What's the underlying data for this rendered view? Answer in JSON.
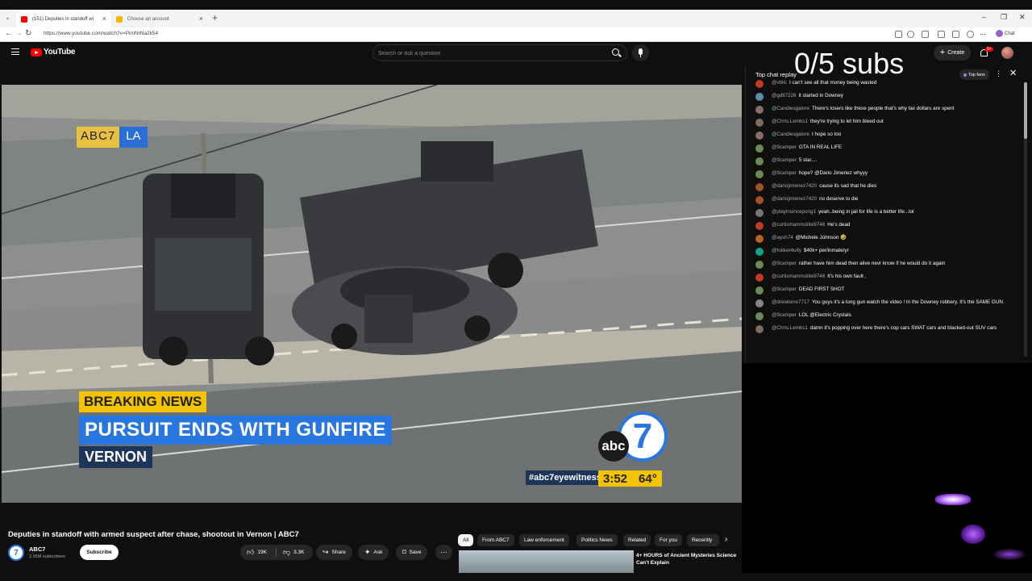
{
  "browser": {
    "tabs": [
      {
        "label": "(151) Deputies in standoff wi"
      },
      {
        "label": "Choose an account"
      }
    ],
    "url": "https://www.youtube.com/watch?v=PimNrNa2k54",
    "chat_label": "Chat"
  },
  "header": {
    "logo_text": "YouTube",
    "search_placeholder": "Search or ask a question",
    "create_label": "Create",
    "notification_count": "9+"
  },
  "video": {
    "bug_left": "ABC7",
    "bug_right": "LA",
    "breaking": "BREAKING NEWS",
    "headline": "PURSUIT ENDS WITH GUNFIRE",
    "location": "VERNON",
    "network_abc": "abc",
    "network_7": "7",
    "hashtag": "#abc7eyewitness",
    "clock": "3:52",
    "temperature": "64°"
  },
  "meta": {
    "title": "Deputies in standoff with armed suspect after chase, shootout in Vernon | ABC7",
    "channel": "ABC7",
    "subscribers": "2.95M subscribers",
    "subscribe_label": "Subscribe",
    "likes": "19K",
    "dislikes": "3.3K",
    "share_label": "Share",
    "ask_label": "Ask",
    "save_label": "Save"
  },
  "chips": [
    "All",
    "From ABC7",
    "Law enforcement",
    "Politics News",
    "Related",
    "For you",
    "Recently"
  ],
  "related": {
    "title": "4+ HOURS of Ancient Mysteries Science Can't Explain"
  },
  "chat": {
    "header": "Top chat replay",
    "top_fans_label": "Top fans",
    "messages": [
      {
        "author": "@vblic",
        "text": "I can't see all that money being wasted",
        "color": "#c0392b"
      },
      {
        "author": "@gdlt7226",
        "text": "it started in Downey",
        "color": "#5b8fa8"
      },
      {
        "author": "@Candlesgalore",
        "text": "There's losers like these people that's why tax dollars are spent",
        "color": "#8e6b6b"
      },
      {
        "author": "@Chris.Lemks1",
        "text": "they're trying to let him bleed out",
        "color": "#7f6a5a"
      },
      {
        "author": "@Candlesgalore",
        "text": "I hope so too",
        "color": "#8e6b6b"
      },
      {
        "author": "@9camper",
        "text": "GTA IN REAL LIFE",
        "color": "#6a8a5a"
      },
      {
        "author": "@9camper",
        "text": "5 star....",
        "color": "#6a8a5a"
      },
      {
        "author": "@9camper",
        "text": "hope? @Dario Jimenez whyyy",
        "color": "#6a8a5a"
      },
      {
        "author": "@dariojimenez7420",
        "text": "cause its sad that he dies",
        "color": "#a0522d"
      },
      {
        "author": "@dariojimenez7420",
        "text": "no deserve to die",
        "color": "#a0522d"
      },
      {
        "author": "@playinsincepong1",
        "text": "yeah..being in jail for life is a better life...lol",
        "color": "#777777"
      },
      {
        "author": "@curtismammolite9746",
        "text": "He's dead",
        "color": "#c0392b"
      },
      {
        "author": "@aysh74",
        "text": "@Michele Johnson 🤣",
        "color": "#b5651d"
      },
      {
        "author": "@fokker4uify",
        "text": "$40k+ per/inmate/yr",
        "color": "#16a085"
      },
      {
        "author": "@9camper",
        "text": "rather have him dead then alive nevr know if he would do it again",
        "color": "#6a8a5a"
      },
      {
        "author": "@curtismammolite9746",
        "text": "It's his own fault ,",
        "color": "#c0392b"
      },
      {
        "author": "@9camper",
        "text": "DEAD FIRST SHOT",
        "color": "#6a8a5a"
      },
      {
        "author": "@drewtorre7717",
        "text": "You guys it's a long gun watch the video ! In the Downey robbery. It's the SAME GUN",
        "color": "#888888"
      },
      {
        "author": "@9camper",
        "text": "LOL @Electric Crystals",
        "color": "#6a8a5a"
      },
      {
        "author": "@Chris.Lemks1",
        "text": "damn it's popping over here there's cop cars SWAT cars and blacked-out SUV cars",
        "color": "#7f6a5a"
      }
    ]
  },
  "overlay": {
    "subs_counter": "0/5 subs"
  }
}
